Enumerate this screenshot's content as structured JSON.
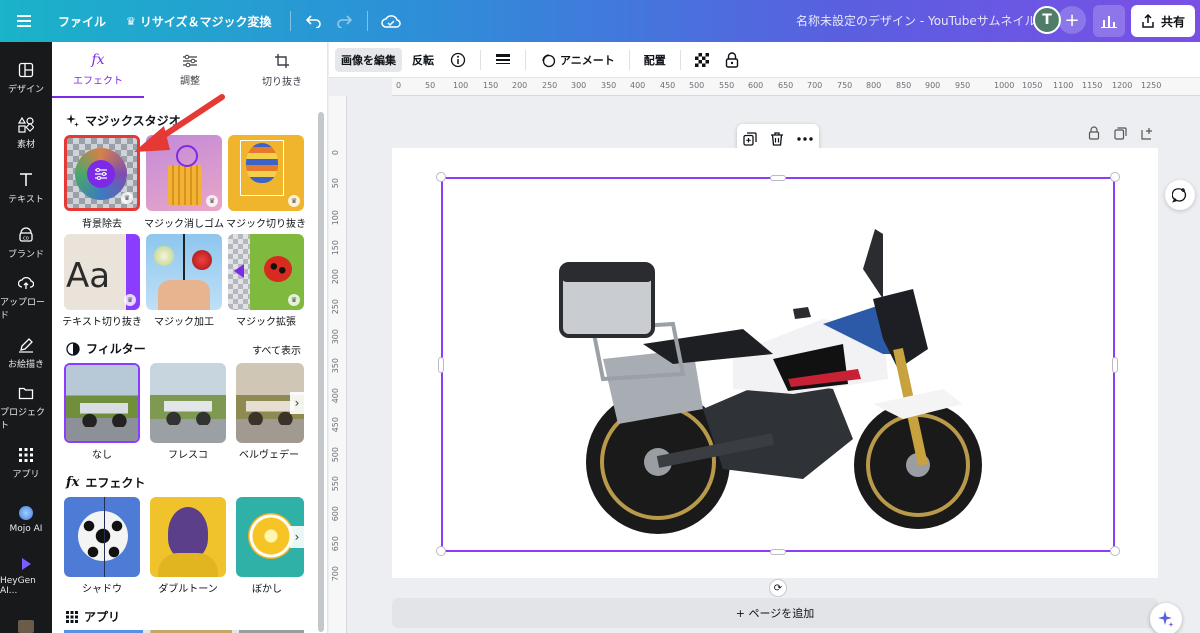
{
  "topbar": {
    "file_label": "ファイル",
    "resize_label": "リサイズ＆マジック変換",
    "doc_title": "名称未設定のデザイン - YouTubeサムネイル",
    "avatar_initial": "T",
    "share_label": "共有"
  },
  "rail": {
    "items": [
      {
        "label": "デザイン",
        "icon": "layout-icon"
      },
      {
        "label": "素材",
        "icon": "elements-icon"
      },
      {
        "label": "テキスト",
        "icon": "text-icon"
      },
      {
        "label": "ブランド",
        "icon": "brand-icon"
      },
      {
        "label": "アップロード",
        "icon": "upload-icon"
      },
      {
        "label": "お絵描き",
        "icon": "draw-icon"
      },
      {
        "label": "プロジェクト",
        "icon": "folder-icon"
      },
      {
        "label": "アプリ",
        "icon": "apps-icon"
      },
      {
        "label": "Mojo AI",
        "icon": "mojo-icon"
      },
      {
        "label": "HeyGen AI...",
        "icon": "heygen-icon"
      }
    ]
  },
  "panel": {
    "tabs": [
      {
        "label": "エフェクト",
        "icon": "fx-icon"
      },
      {
        "label": "調整",
        "icon": "sliders-icon"
      },
      {
        "label": "切り抜き",
        "icon": "crop-icon"
      }
    ],
    "magic_studio": {
      "title": "マジックスタジオ",
      "tiles": [
        {
          "label": "背景除去"
        },
        {
          "label": "マジック消しゴム"
        },
        {
          "label": "マジック切り抜き"
        },
        {
          "label": "テキスト切り抜き"
        },
        {
          "label": "マジック加工"
        },
        {
          "label": "マジック拡張"
        }
      ]
    },
    "filters": {
      "title": "フィルター",
      "see_all": "すべて表示",
      "tiles": [
        {
          "label": "なし"
        },
        {
          "label": "フレスコ"
        },
        {
          "label": "ベルヴェデー"
        }
      ]
    },
    "effects": {
      "title": "エフェクト",
      "tiles": [
        {
          "label": "シャドウ"
        },
        {
          "label": "ダブルトーン"
        },
        {
          "label": "ぼかし"
        }
      ]
    },
    "apps": {
      "title": "アプリ"
    }
  },
  "context_toolbar": {
    "edit_image": "画像を編集",
    "flip": "反転",
    "animate": "アニメート",
    "position": "配置"
  },
  "ruler": {
    "top": [
      "0",
      "50",
      "100",
      "150",
      "200",
      "250",
      "300",
      "350",
      "400",
      "450",
      "500",
      "550",
      "600",
      "650",
      "700",
      "750",
      "800",
      "850",
      "900",
      "950",
      "1000",
      "1050",
      "1100",
      "1150",
      "1200",
      "1250"
    ],
    "left": [
      "0",
      "50",
      "100",
      "150",
      "200",
      "250",
      "300",
      "350",
      "400",
      "450",
      "500",
      "550",
      "600",
      "650",
      "700"
    ]
  },
  "canvas": {
    "add_page": "+ ページを追加"
  },
  "colors": {
    "accent": "#8b3dff",
    "rail_bg": "#18191b",
    "highlight_red": "#e53935"
  }
}
